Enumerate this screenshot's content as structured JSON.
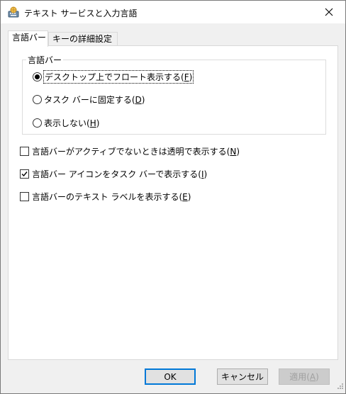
{
  "window": {
    "title": "テキスト サービスと入力言語"
  },
  "tabs": [
    {
      "label": "言語バー",
      "active": true
    },
    {
      "label": "キーの詳細設定",
      "active": false
    }
  ],
  "group": {
    "label": "言語バー",
    "options": [
      {
        "text": "デスクトップ上でフロート表示する(",
        "key": "F",
        "tail": ")",
        "checked": true
      },
      {
        "text": "タスク バーに固定する(",
        "key": "D",
        "tail": ")",
        "checked": false
      },
      {
        "text": "表示しない(",
        "key": "H",
        "tail": ")",
        "checked": false
      }
    ]
  },
  "checkboxes": [
    {
      "text": "言語バーがアクティブでないときは透明で表示する(",
      "key": "N",
      "tail": ")",
      "checked": false
    },
    {
      "text": "言語バー アイコンをタスク バーで表示する(",
      "key": "I",
      "tail": ")",
      "checked": true
    },
    {
      "text": "言語バーのテキスト ラベルを表示する(",
      "key": "E",
      "tail": ")",
      "checked": false
    }
  ],
  "buttons": {
    "ok": "OK",
    "cancel": "キャンセル",
    "apply": {
      "text": "適用(",
      "key": "A",
      "tail": ")"
    }
  },
  "icons": {
    "app": "keyboard-globe-icon",
    "close": "close-icon",
    "check": "checkmark-icon",
    "grip": "resize-grip-icon"
  }
}
